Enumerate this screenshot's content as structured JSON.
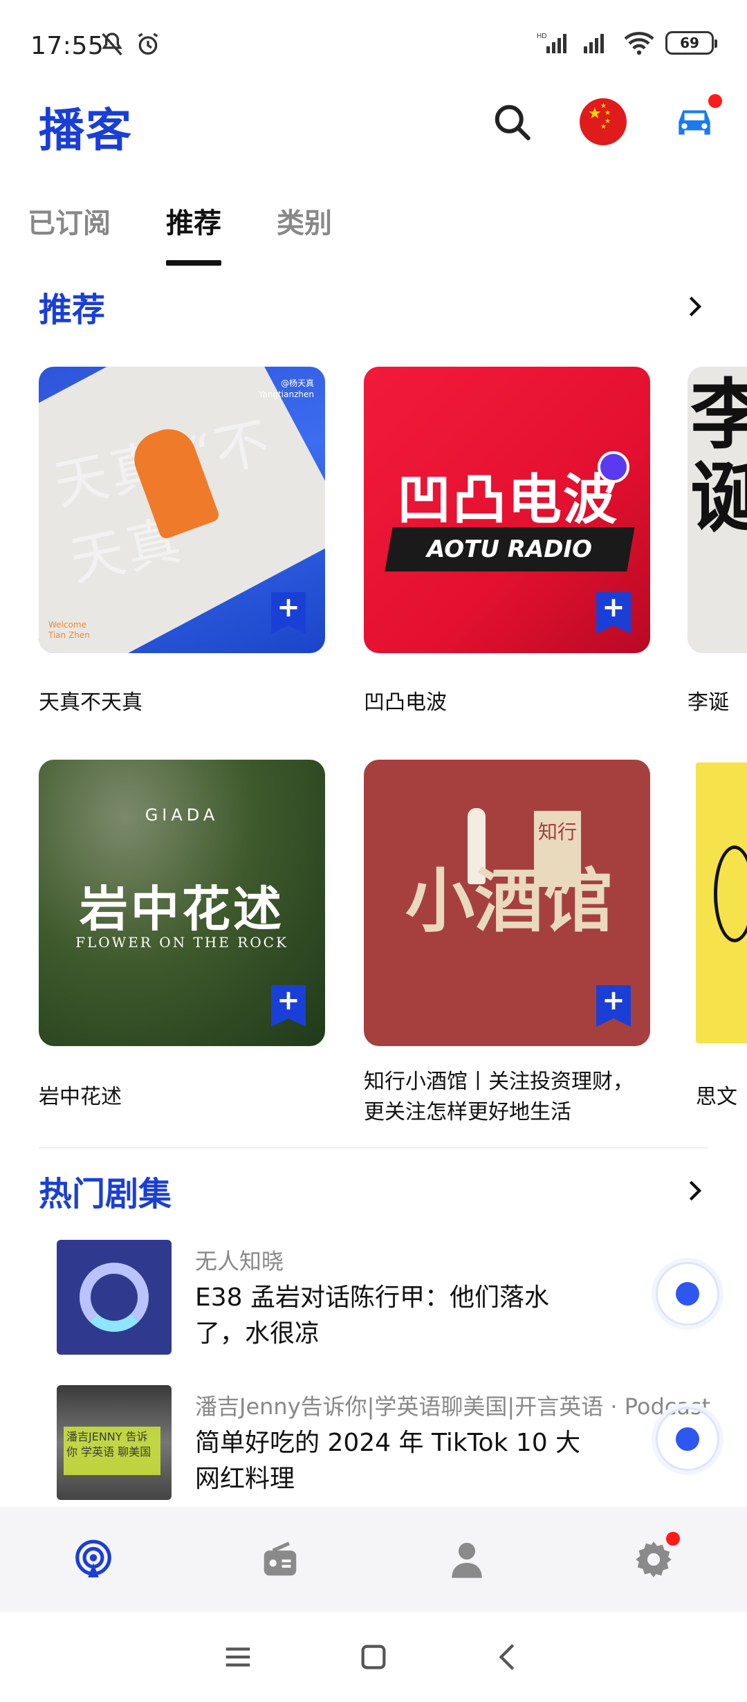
{
  "status_bar": {
    "time": "17:55",
    "battery": "69",
    "network_label": "HD"
  },
  "header": {
    "title": "播客"
  },
  "tabs": [
    {
      "label": "已订阅",
      "active": false
    },
    {
      "label": "推荐",
      "active": true
    },
    {
      "label": "类别",
      "active": false
    }
  ],
  "recommend": {
    "title": "推荐",
    "cards": [
      {
        "title": "天真不天真",
        "cover_text": "天真 “不天真”",
        "cover_sub": "Welcome Tian Zhen",
        "cover_tag": "@杨天真 Yangtianzhen"
      },
      {
        "title": "凹凸电波",
        "cover_text": "凹凸电波",
        "cover_sub": "AOTU RADIO"
      },
      {
        "title": "李诞",
        "cover_text": "李诞"
      },
      {
        "title": "岩中花述",
        "cover_text": "岩中花述",
        "cover_sub": "FLOWER ON THE ROCK",
        "cover_top": "GIADA"
      },
      {
        "title": "知行小酒馆丨关注投资理财，更关注怎样更好地生活",
        "cover_text": "小酒馆",
        "cover_tag": "知行"
      },
      {
        "title": "思文"
      }
    ]
  },
  "hot": {
    "title": "热门剧集",
    "episodes": [
      {
        "show": "无人知晓",
        "title": "E38 孟岩对话陈行甲：他们落水了，水很凉"
      },
      {
        "show": "潘吉Jenny告诉你|学英语聊美国|开言英语 · Podcast",
        "title": "简单好吃的 2024 年 TikTok 10 大网红料理",
        "thumb_text": "潘吉JENNY 告诉你 学英语 聊美国"
      }
    ]
  },
  "colors": {
    "accent": "#1a3fd6",
    "notify": "#ff1a1a"
  },
  "icons": {
    "search": "search-icon",
    "car": "car-icon",
    "settings": "gear-icon"
  }
}
